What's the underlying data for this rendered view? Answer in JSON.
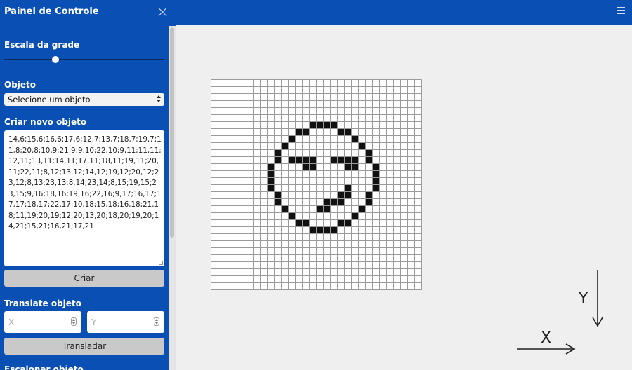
{
  "panel": {
    "title": "Painel de Controle",
    "grid_scale_label": "Escala da grade",
    "grid_scale_value": 0.31,
    "object_label": "Objeto",
    "object_select_value": "Selecione um objeto",
    "create_label": "Criar novo objeto",
    "create_text": "14,6;15,6;16,6;17,6;12,7;13,7;18,7;19,7;11,8;20,8;10,9;21,9;9,10;22,10;9,11;11,11;12,11;13,11;14,11;17,11;18,11;19,11;20,11;22,11;8,12;13,12;14,12;19,12;20,12;23,12;8,13;23,13;8,14;23,14;8,15;19,15;23,15;9,16;18,16;19,16;22,16;9,17;16,17;17,17;18,17;22,17;10,18;15,18;16,18;21,18;11,19;20,19;12,20;13,20;18,20;19,20;14,21;15,21;16,21;17,21",
    "create_button": "Criar",
    "translate_label": "Translate objeto",
    "translate_x_placeholder": "X",
    "translate_y_placeholder": "Y",
    "translate_button": "Transladar",
    "scale_label": "Escalonar objeto"
  },
  "canvas": {
    "grid_cols": 30,
    "grid_rows": 30,
    "filled_cells": [
      [
        14,
        6
      ],
      [
        15,
        6
      ],
      [
        16,
        6
      ],
      [
        17,
        6
      ],
      [
        12,
        7
      ],
      [
        13,
        7
      ],
      [
        18,
        7
      ],
      [
        19,
        7
      ],
      [
        11,
        8
      ],
      [
        20,
        8
      ],
      [
        10,
        9
      ],
      [
        21,
        9
      ],
      [
        9,
        10
      ],
      [
        22,
        10
      ],
      [
        9,
        11
      ],
      [
        11,
        11
      ],
      [
        12,
        11
      ],
      [
        13,
        11
      ],
      [
        14,
        11
      ],
      [
        17,
        11
      ],
      [
        18,
        11
      ],
      [
        19,
        11
      ],
      [
        20,
        11
      ],
      [
        22,
        11
      ],
      [
        8,
        12
      ],
      [
        13,
        12
      ],
      [
        14,
        12
      ],
      [
        19,
        12
      ],
      [
        20,
        12
      ],
      [
        23,
        12
      ],
      [
        8,
        13
      ],
      [
        23,
        13
      ],
      [
        8,
        14
      ],
      [
        23,
        14
      ],
      [
        8,
        15
      ],
      [
        19,
        15
      ],
      [
        23,
        15
      ],
      [
        9,
        16
      ],
      [
        18,
        16
      ],
      [
        19,
        16
      ],
      [
        22,
        16
      ],
      [
        9,
        17
      ],
      [
        16,
        17
      ],
      [
        17,
        17
      ],
      [
        18,
        17
      ],
      [
        22,
        17
      ],
      [
        10,
        18
      ],
      [
        15,
        18
      ],
      [
        16,
        18
      ],
      [
        21,
        18
      ],
      [
        11,
        19
      ],
      [
        20,
        19
      ],
      [
        12,
        20
      ],
      [
        13,
        20
      ],
      [
        18,
        20
      ],
      [
        19,
        20
      ],
      [
        14,
        21
      ],
      [
        15,
        21
      ],
      [
        16,
        21
      ],
      [
        17,
        21
      ]
    ],
    "axis_x_label": "X",
    "axis_y_label": "Y"
  },
  "colors": {
    "panel_bg": "#0a4fb3",
    "canvas_bg": "#efefef",
    "cell_fill": "#111111",
    "grid_line": "#9a9a9a"
  },
  "icons": {
    "close": "close-icon",
    "menu": "menu-icon"
  }
}
